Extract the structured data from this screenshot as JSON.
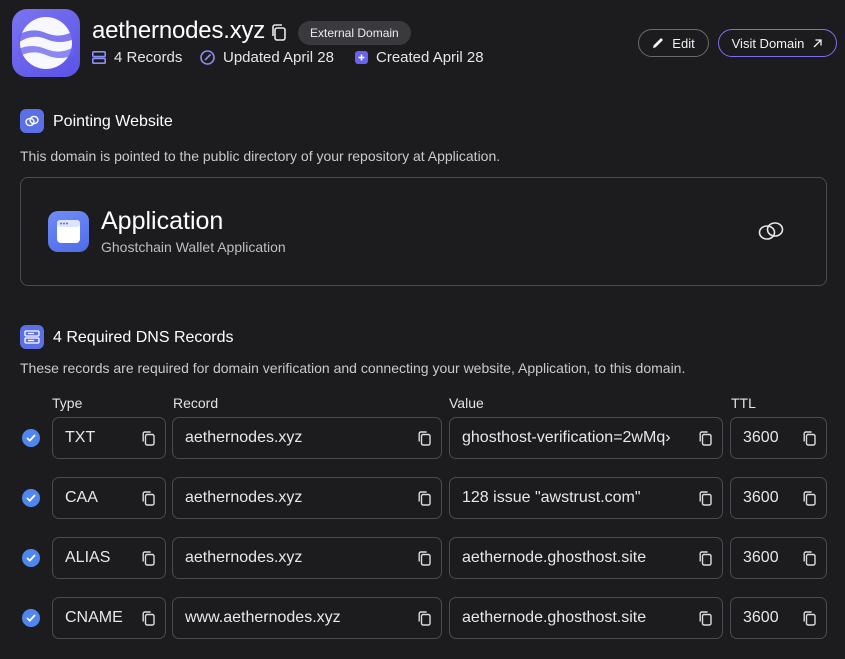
{
  "header": {
    "domain": "aethernodes.xyz",
    "badge": "External Domain",
    "records_count": "4 Records",
    "updated": "Updated April 28",
    "created": "Created April 28",
    "edit_label": "Edit",
    "visit_label": "Visit Domain"
  },
  "pointing": {
    "title": "Pointing Website",
    "description": "This domain is pointed to the public directory of your repository at Application.",
    "app_name": "Application",
    "app_subtitle": "Ghostchain Wallet Application"
  },
  "dns": {
    "title": "4 Required DNS Records",
    "description": "These records are required for domain verification and connecting your website, Application, to this domain.",
    "columns": {
      "type": "Type",
      "record": "Record",
      "value": "Value",
      "ttl": "TTL"
    },
    "rows": [
      {
        "type": "TXT",
        "record": "aethernodes.xyz",
        "value": "ghosthost-verification=2wMq›",
        "ttl": "3600"
      },
      {
        "type": "CAA",
        "record": "aethernodes.xyz",
        "value": "128 issue \"awstrust.com\"",
        "ttl": "3600"
      },
      {
        "type": "ALIAS",
        "record": "aethernodes.xyz",
        "value": "aethernode.ghosthost.site",
        "ttl": "3600"
      },
      {
        "type": "CNAME",
        "record": "www.aethernodes.xyz",
        "value": "aethernode.ghosthost.site",
        "ttl": "3600"
      }
    ]
  },
  "colors": {
    "background": "#1c1c1e",
    "accent": "#5b6fe6",
    "check": "#4f86f0",
    "visit_border": "#7b6ff0"
  },
  "icons": [
    "domain-logo",
    "copy-icon",
    "records-icon",
    "updated-icon",
    "created-icon",
    "pencil-icon",
    "arrow-up-right-icon",
    "link-icon",
    "app-window-icon",
    "server-icon",
    "check-icon"
  ]
}
